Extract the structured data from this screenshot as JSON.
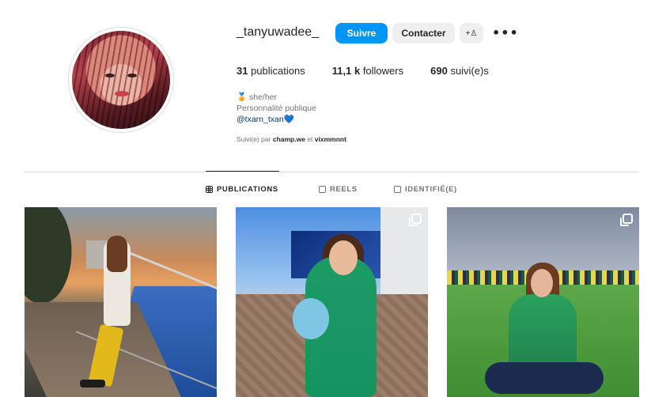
{
  "profile": {
    "username": "_tanyuwadee_",
    "follow_label": "Suivre",
    "contact_label": "Contacter",
    "add_label": "+♙",
    "more_label": "•••"
  },
  "stats": {
    "posts_value": "31",
    "posts_label": "publications",
    "followers_value": "11,1 k",
    "followers_label": "followers",
    "following_value": "690",
    "following_label": "suivi(e)s"
  },
  "bio": {
    "pronoun_emoji": "🏅",
    "pronouns": "she/her",
    "category": "Personnalité publique",
    "link": "@txarn_txan",
    "link_emoji": "💙"
  },
  "followed_by": {
    "prefix": "Suivi(e) par",
    "user1": "champ.we",
    "joiner": "et",
    "user2": "vixmmnnt"
  },
  "tabs": [
    {
      "label": "PUBLICATIONS",
      "icon": "grid-icon",
      "active": true
    },
    {
      "label": "REELS",
      "icon": "reels-icon",
      "active": false
    },
    {
      "label": "IDENTIFIÉ(E)",
      "icon": "tagged-icon",
      "active": false
    }
  ],
  "colors": {
    "accent": "#0095f6",
    "button_secondary": "#efefef",
    "text_primary": "#262626",
    "text_secondary": "#737373",
    "link": "#00376b"
  }
}
